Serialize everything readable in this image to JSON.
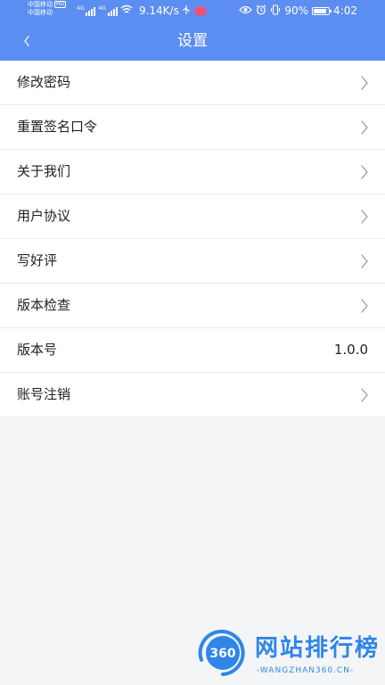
{
  "status_bar": {
    "carrier_1": "中国移动",
    "hd_badge": "HD",
    "carrier_2": "中国移动",
    "signal_tag_1": "4G",
    "signal_tag_2": "4G",
    "network_speed": "9.14K/s",
    "battery_percent": "90%",
    "battery_level": 0.9,
    "time": "4:02"
  },
  "header": {
    "title": "设置",
    "background_color": "#5b8ef0"
  },
  "settings": {
    "items": [
      {
        "label": "修改密码",
        "icon": "chevron-right-icon"
      },
      {
        "label": "重置签名口令",
        "icon": "chevron-right-icon"
      },
      {
        "label": "关于我们",
        "icon": "chevron-right-icon"
      },
      {
        "label": "用户协议",
        "icon": "chevron-right-icon"
      },
      {
        "label": "写好评",
        "icon": "chevron-right-icon"
      },
      {
        "label": "版本检查",
        "icon": "chevron-right-icon"
      },
      {
        "label": "版本号",
        "value": "1.0.0"
      },
      {
        "label": "账号注销",
        "icon": "chevron-right-icon"
      }
    ]
  },
  "watermark": {
    "logo_text": "360",
    "title": "网站排行榜",
    "subtitle": "-WANGZHAN360.CN-",
    "color": "#2f86e8"
  }
}
